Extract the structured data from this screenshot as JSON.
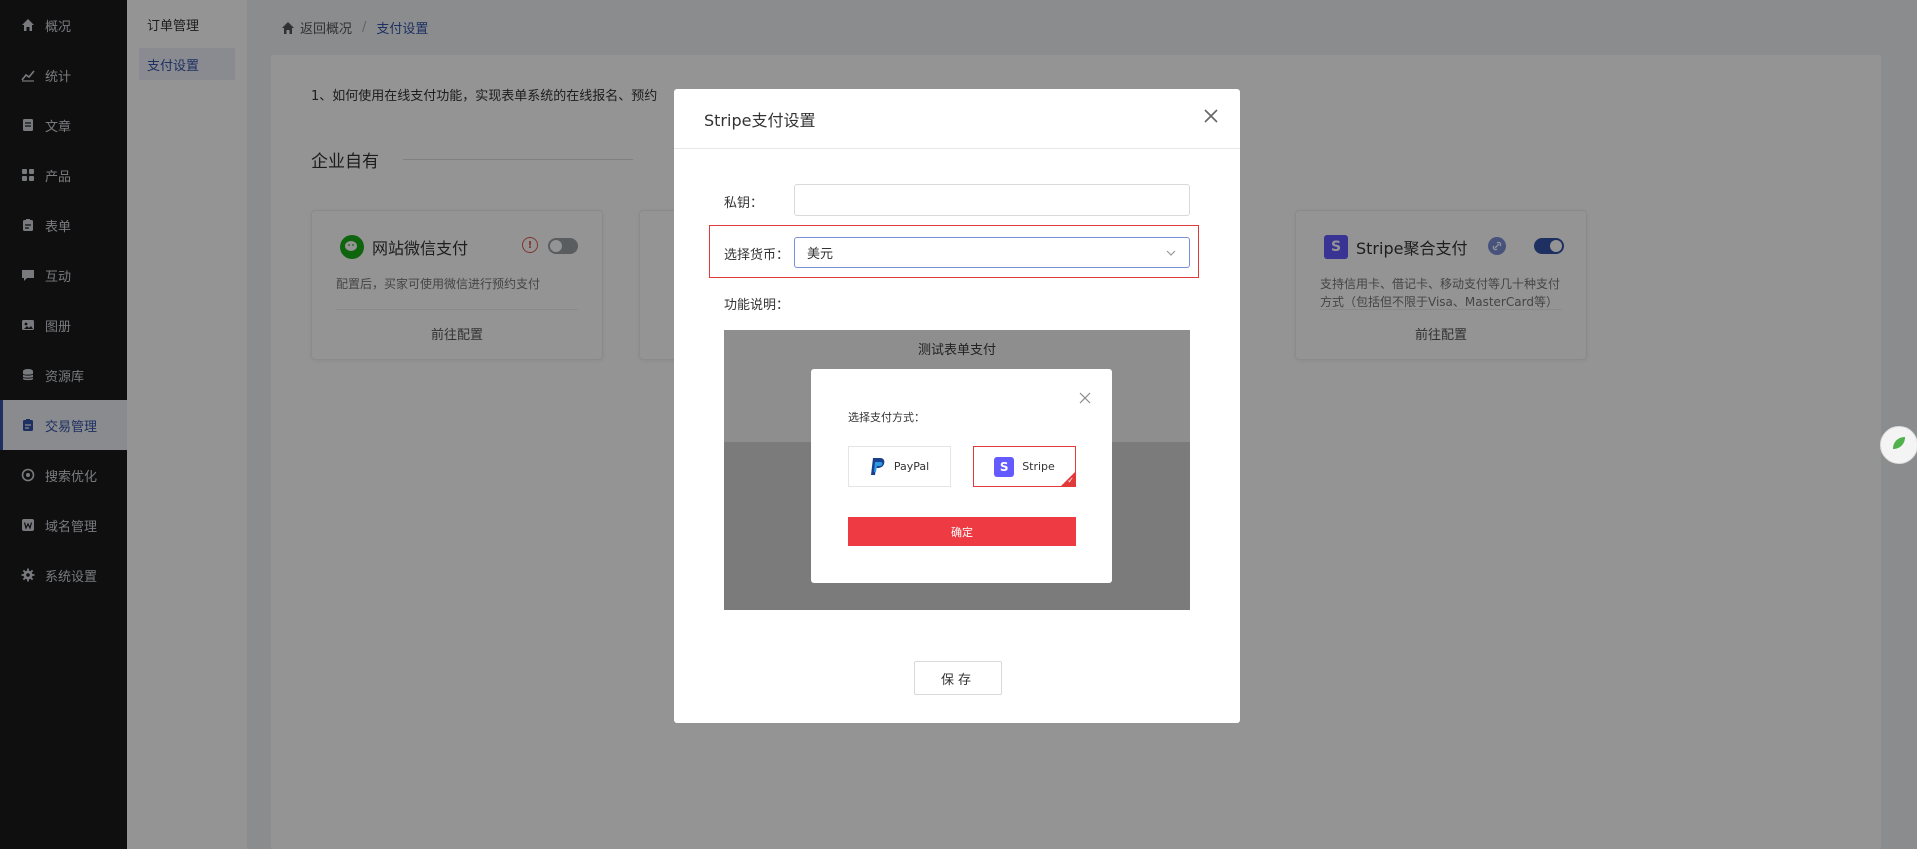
{
  "sidebar": {
    "items": [
      {
        "label": "概况",
        "icon": "home-icon"
      },
      {
        "label": "统计",
        "icon": "stats-icon"
      },
      {
        "label": "文章",
        "icon": "article-icon"
      },
      {
        "label": "产品",
        "icon": "product-icon"
      },
      {
        "label": "表单",
        "icon": "form-icon"
      },
      {
        "label": "互动",
        "icon": "chat-icon"
      },
      {
        "label": "图册",
        "icon": "gallery-icon"
      },
      {
        "label": "资源库",
        "icon": "database-icon"
      },
      {
        "label": "交易管理",
        "icon": "trade-icon",
        "active": true
      },
      {
        "label": "搜索优化",
        "icon": "seo-icon"
      },
      {
        "label": "域名管理",
        "icon": "domain-icon"
      },
      {
        "label": "系统设置",
        "icon": "gear-icon"
      }
    ]
  },
  "subnav": {
    "items": [
      {
        "label": "订单管理"
      },
      {
        "label": "支付设置",
        "active": true
      }
    ]
  },
  "breadcrumb": {
    "back": "返回概况",
    "separator": "/",
    "current": "支付设置"
  },
  "main": {
    "hint": "1、如何使用在线支付功能，实现表单系统的在线报名、预约",
    "section_title": "企业自有",
    "cards": [
      {
        "title": "网站微信支付",
        "desc": "配置后，买家可使用微信进行预约支付",
        "config": "前往配置",
        "toggle": "off"
      },
      {
        "title": "Stripe聚合支付",
        "desc": "支持信用卡、借记卡、移动支付等几十种支付方式（包括但不限于Visa、MasterCard等）",
        "config": "前往配置",
        "toggle": "on"
      }
    ]
  },
  "modal": {
    "title": "Stripe支付设置",
    "secret_key_label": "私钥：",
    "secret_key_value": "",
    "currency_label": "选择货币：",
    "currency_value": "美元",
    "feature_label": "功能说明：",
    "preview": {
      "title": "测试表单支付",
      "dialog_label": "选择支付方式：",
      "options": [
        {
          "label": "PayPal",
          "icon": "paypal-icon"
        },
        {
          "label": "Stripe",
          "icon": "stripe-icon",
          "selected": true
        }
      ],
      "confirm": "确定"
    },
    "save": "保存"
  },
  "colors": {
    "accent": "#3454a8",
    "highlight_red": "#e23a3a",
    "confirm_red": "#ee3a42",
    "wechat_green": "#1aad19",
    "stripe_purple": "#635bff"
  }
}
